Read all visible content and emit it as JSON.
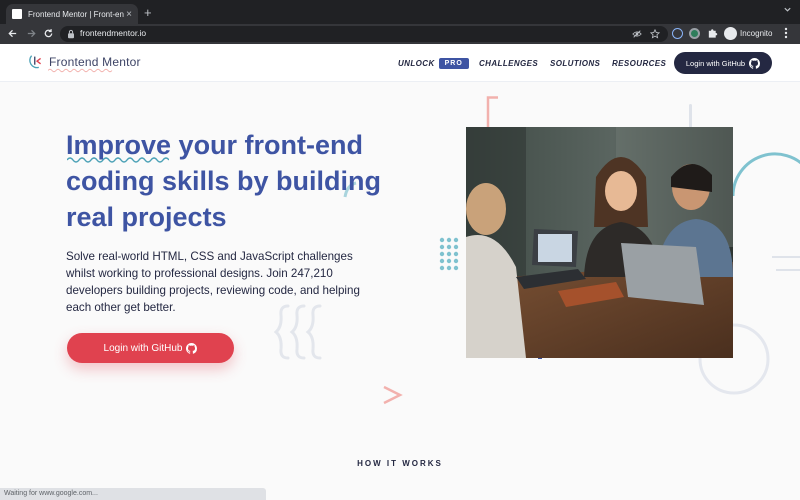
{
  "browser": {
    "tab_title": "Frontend Mentor | Front-end coding challenges",
    "tab_close_glyph": "×",
    "new_tab_glyph": "+",
    "url": "frontendmentor.io",
    "incognito_label": "Incognito",
    "status_text": "Waiting for www.google.com..."
  },
  "site": {
    "logo_text": "Frontend Mentor",
    "nav": {
      "unlock_label": "UNLOCK",
      "pro_badge": "PRO",
      "challenges_label": "CHALLENGES",
      "solutions_label": "SOLUTIONS",
      "resources_label": "RESOURCES",
      "login_label": "Login with GitHub"
    },
    "hero": {
      "title_line1_first": "Improve",
      "title_line1_rest": " your front-end",
      "title_line2": "coding skills by building",
      "title_line3": "real projects",
      "description": "Solve real-world HTML, CSS and JavaScript challenges whilst working to professional designs. Join 247,210 developers building projects, reviewing code, and helping each other get better.",
      "cta_label": "Login with GitHub"
    },
    "how_it_works_heading": "HOW IT WORKS"
  },
  "colors": {
    "brand_blue": "#3e54a3",
    "cta_red": "#e0424f",
    "dark_navy": "#242842",
    "accent_teal": "#4ba1b6",
    "accent_pink": "#f2b1ad"
  },
  "icons": [
    "lock-icon",
    "github-icon",
    "back-arrow-icon",
    "forward-arrow-icon",
    "reload-icon",
    "star-icon",
    "eye-off-icon",
    "puzzle-icon"
  ]
}
